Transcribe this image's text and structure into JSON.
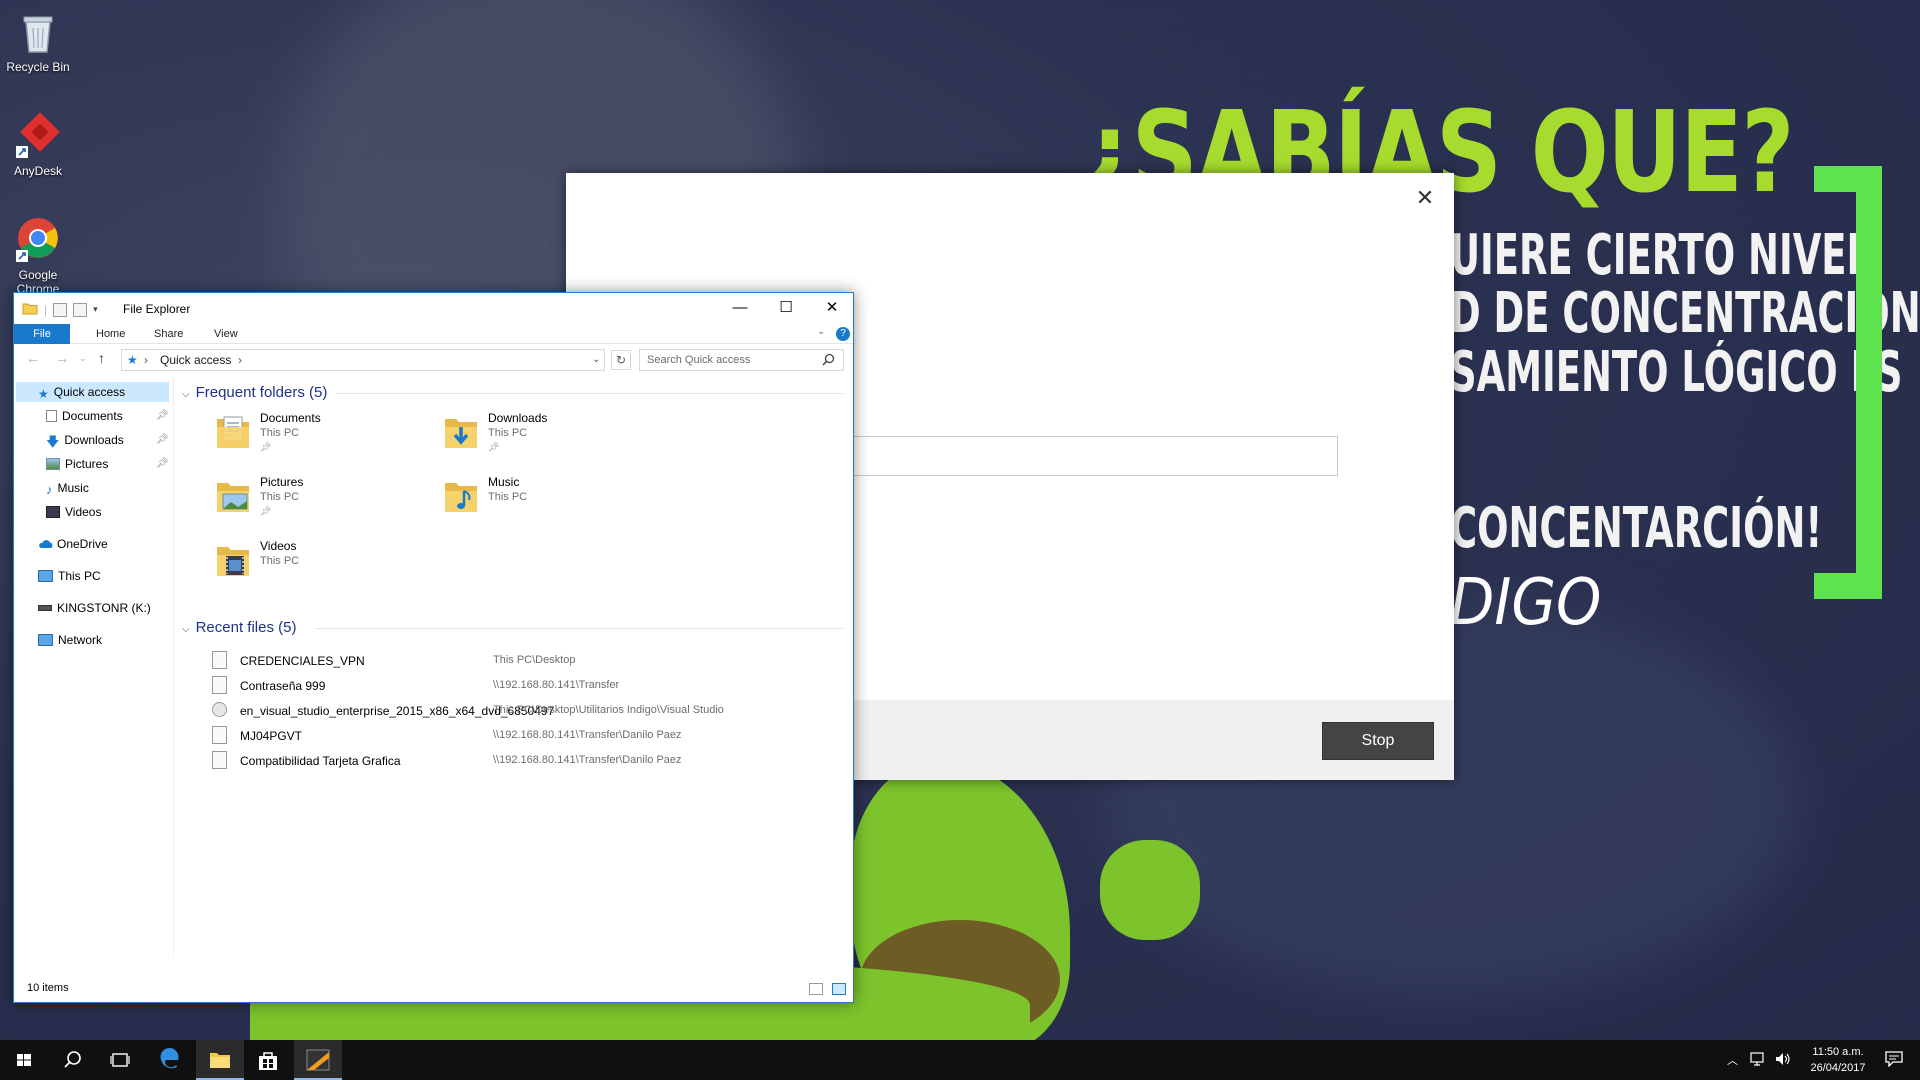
{
  "wallpaper": {
    "headline": "¿SABÍAS QUE?",
    "lines": [
      "UIERE   CIERTO   NIVEL",
      "D DE CONCENTRACIÓN,",
      "SAMIENTO  LÓGICO  ES",
      "CONCENTARCIÓN!"
    ],
    "brand": "DIGO",
    "accent_color": "#a7dc2e",
    "bracket_color": "#5ee34e"
  },
  "desktop_icons": [
    {
      "label": "Recycle Bin",
      "icon": "recycle-bin-icon"
    },
    {
      "label": "AnyDesk",
      "icon": "anydesk-icon"
    },
    {
      "label": "Google Chrome",
      "icon": "chrome-icon"
    }
  ],
  "dialog": {
    "close_glyph": "✕",
    "stop_label": "Stop"
  },
  "explorer": {
    "title": "File Explorer",
    "ribbon_tabs": [
      "File",
      "Home",
      "Share",
      "View"
    ],
    "address": {
      "path": "Quick access",
      "separator": "›"
    },
    "search_placeholder": "Search Quick access",
    "nav": [
      {
        "label": "Quick access",
        "icon": "star-icon",
        "selected": true
      },
      {
        "label": "Documents",
        "icon": "documents-icon",
        "pinned": true
      },
      {
        "label": "Downloads",
        "icon": "downloads-icon",
        "pinned": true
      },
      {
        "label": "Pictures",
        "icon": "pictures-icon",
        "pinned": true
      },
      {
        "label": "Music",
        "icon": "music-icon"
      },
      {
        "label": "Videos",
        "icon": "videos-icon"
      },
      {
        "label": "OneDrive",
        "icon": "onedrive-icon"
      },
      {
        "label": "This PC",
        "icon": "this-pc-icon"
      },
      {
        "label": "KINGSTONR (K:)",
        "icon": "usb-drive-icon"
      },
      {
        "label": "Network",
        "icon": "network-icon"
      }
    ],
    "frequent_header": "Frequent folders (5)",
    "folders": [
      {
        "name": "Documents",
        "location": "This PC",
        "pinned": true
      },
      {
        "name": "Downloads",
        "location": "This PC",
        "pinned": true
      },
      {
        "name": "Pictures",
        "location": "This PC",
        "pinned": true
      },
      {
        "name": "Music",
        "location": "This PC",
        "pinned": false
      },
      {
        "name": "Videos",
        "location": "This PC",
        "pinned": false
      }
    ],
    "recent_header": "Recent files (5)",
    "files": [
      {
        "name": "CREDENCIALES_VPN",
        "path": "This PC\\Desktop"
      },
      {
        "name": "Contraseña 999",
        "path": "\\\\192.168.80.141\\Transfer"
      },
      {
        "name": "en_visual_studio_enterprise_2015_x86_x64_dvd_6850497",
        "path": "This PC\\Desktop\\Utilitarios Indigo\\Visual Studio"
      },
      {
        "name": "MJ04PGVT",
        "path": "\\\\192.168.80.141\\Transfer\\Danilo Paez"
      },
      {
        "name": "Compatibilidad Tarjeta Grafica",
        "path": "\\\\192.168.80.141\\Transfer\\Danilo Paez"
      }
    ],
    "status": "10 items"
  },
  "taskbar": {
    "time": "11:50 a.m.",
    "date": "26/04/2017"
  }
}
